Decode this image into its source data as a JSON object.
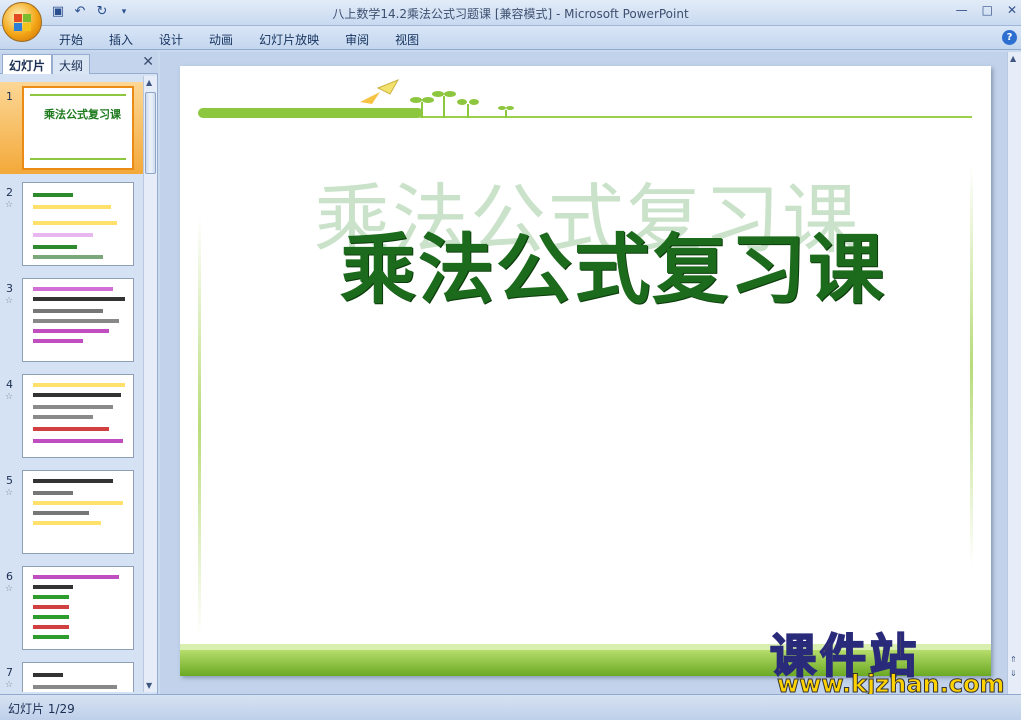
{
  "window": {
    "title": "八上数学14.2乘法公式习题课 [兼容模式] - Microsoft PowerPoint"
  },
  "quick_access": {
    "save_icon": "save-icon",
    "undo_icon": "undo-icon",
    "redo_icon": "redo-icon"
  },
  "ribbon": {
    "tabs": [
      "开始",
      "插入",
      "设计",
      "动画",
      "幻灯片放映",
      "审阅",
      "视图"
    ]
  },
  "left_pane": {
    "tab_slides": "幻灯片",
    "tab_outline": "大纲",
    "thumbnails": [
      {
        "num": "1",
        "title": "乘法公式复习课"
      },
      {
        "num": "2",
        "title": ""
      },
      {
        "num": "3",
        "title": ""
      },
      {
        "num": "4",
        "title": ""
      },
      {
        "num": "5",
        "title": ""
      },
      {
        "num": "6",
        "title": ""
      },
      {
        "num": "7",
        "title": ""
      }
    ]
  },
  "slide": {
    "title": "乘法公式复习课",
    "ghost_title": "乘法公式复习课"
  },
  "watermark": {
    "line1": "课件站",
    "line2": "www.kjzhan.com"
  },
  "status": {
    "slide_counter": "幻灯片 1/29"
  }
}
